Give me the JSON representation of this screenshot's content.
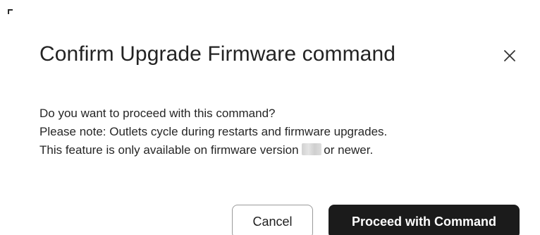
{
  "dialog": {
    "title": "Confirm Upgrade Firmware command",
    "close_icon": "close-icon",
    "message_lines": [
      "Do you want to proceed with this command?",
      "Please note: Outlets cycle during restarts and firmware upgrades."
    ],
    "feature_note_prefix": "This feature is only available on firmware version",
    "feature_note_suffix": "or newer.",
    "buttons": {
      "cancel_label": "Cancel",
      "proceed_label": "Proceed with Command"
    },
    "colors": {
      "primary_button_bg": "#1b1b1b",
      "primary_button_text": "#ffffff",
      "secondary_button_border": "#9a9a9a"
    }
  }
}
